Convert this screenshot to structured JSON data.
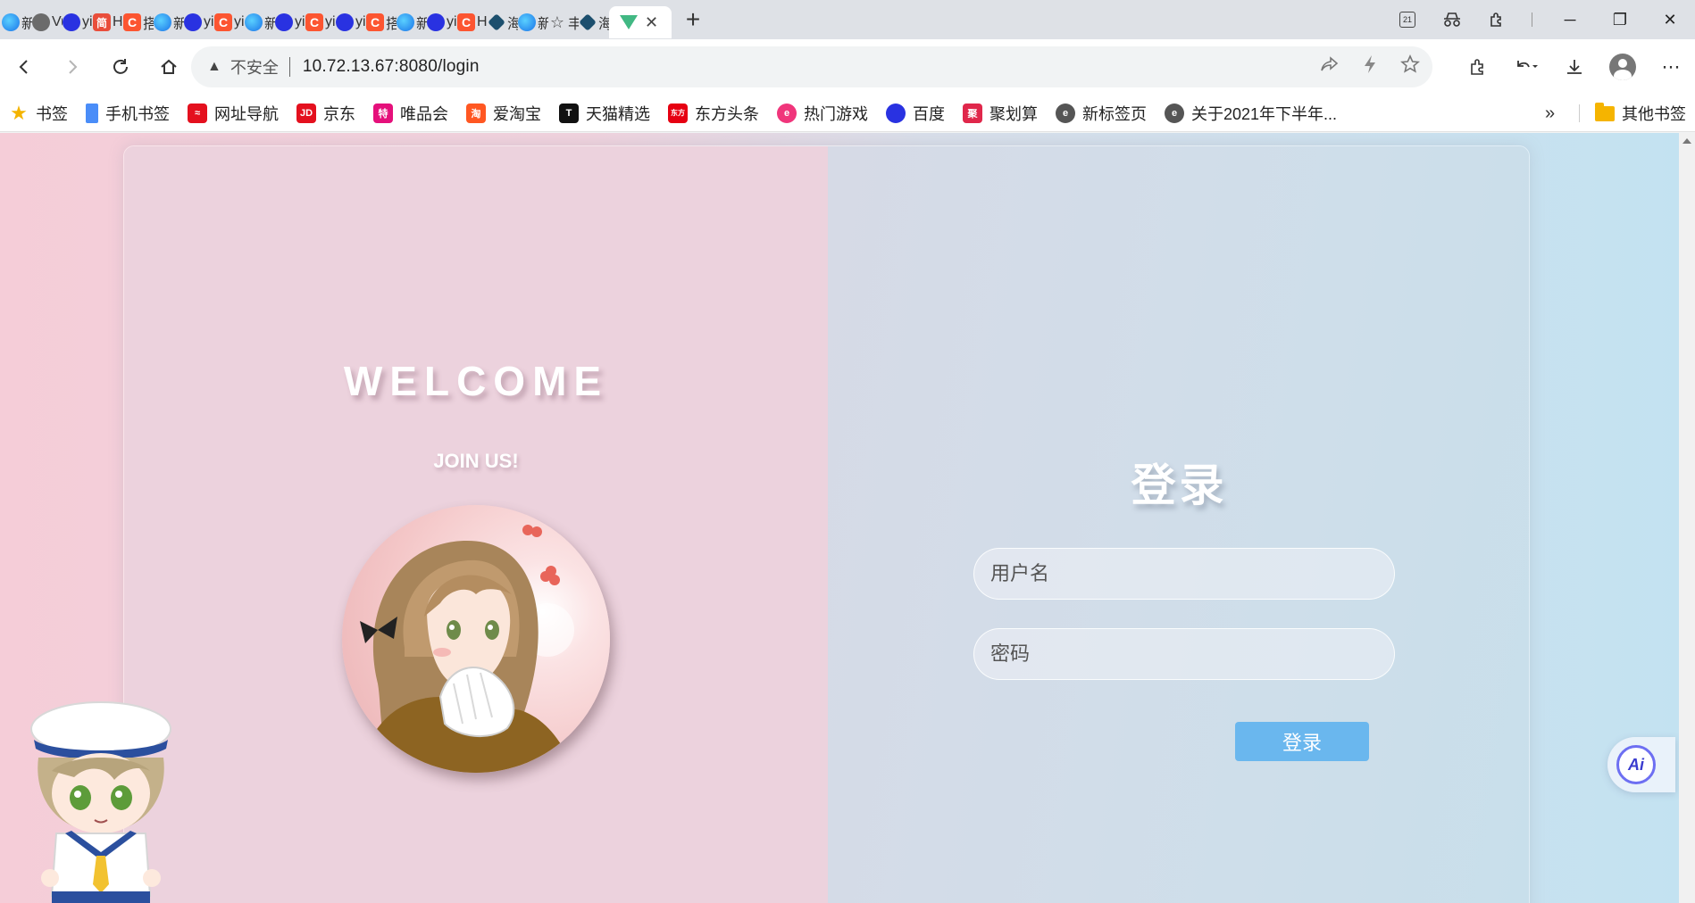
{
  "browser": {
    "tabs": [
      {
        "icon": "edge",
        "glyph": "",
        "title": "新"
      },
      {
        "icon": "ie",
        "glyph": "",
        "title": "Vu"
      },
      {
        "icon": "baidu",
        "glyph": "",
        "title": "yi"
      },
      {
        "icon": "jian",
        "glyph": "简",
        "title": "H"
      },
      {
        "icon": "csdn",
        "glyph": "C",
        "title": "搭"
      },
      {
        "icon": "edge",
        "glyph": "",
        "title": "新"
      },
      {
        "icon": "baidu",
        "glyph": "",
        "title": "yi"
      },
      {
        "icon": "csdn",
        "glyph": "C",
        "title": "yi"
      },
      {
        "icon": "edge",
        "glyph": "",
        "title": "新"
      },
      {
        "icon": "baidu",
        "glyph": "",
        "title": "yi"
      },
      {
        "icon": "csdn",
        "glyph": "C",
        "title": "yi"
      },
      {
        "icon": "baidu",
        "glyph": "",
        "title": "yi"
      },
      {
        "icon": "csdn",
        "glyph": "C",
        "title": "搭"
      },
      {
        "icon": "edge",
        "glyph": "",
        "title": "新"
      },
      {
        "icon": "baidu",
        "glyph": "",
        "title": "yi"
      },
      {
        "icon": "csdn",
        "glyph": "C",
        "title": "H"
      },
      {
        "icon": "haihe",
        "glyph": "",
        "title": "海"
      },
      {
        "icon": "edge",
        "glyph": "",
        "title": "新"
      },
      {
        "icon": "star",
        "glyph": "☆",
        "title": "丰"
      },
      {
        "icon": "haihe",
        "glyph": "",
        "title": "海"
      }
    ],
    "active_tab": {
      "icon": "vue",
      "close": "✕"
    },
    "new_tab": "+",
    "address": {
      "warning_icon": "▲",
      "insecure_label": "不安全",
      "url": "10.72.13.67:8080/login"
    },
    "bookmarks": [
      {
        "icon": "star",
        "glyph": "★",
        "label": "书签"
      },
      {
        "icon": "phone",
        "glyph": "",
        "label": "手机书签"
      },
      {
        "icon": "red",
        "glyph": "≈",
        "label": "网址导航"
      },
      {
        "icon": "red",
        "glyph": "JD",
        "label": "京东"
      },
      {
        "icon": "pink",
        "glyph": "特",
        "label": "唯品会"
      },
      {
        "icon": "orange",
        "glyph": "淘",
        "label": "爱淘宝"
      },
      {
        "icon": "black",
        "glyph": "T",
        "label": "天猫精选"
      },
      {
        "icon": "eastred",
        "glyph": "东方",
        "label": "东方头条"
      },
      {
        "icon": "game",
        "glyph": "e",
        "label": "热门游戏"
      },
      {
        "icon": "baidu",
        "glyph": "",
        "label": "百度"
      },
      {
        "icon": "ju",
        "glyph": "聚",
        "label": "聚划算"
      },
      {
        "icon": "ie",
        "glyph": "e",
        "label": "新标签页"
      },
      {
        "icon": "ie",
        "glyph": "e",
        "label": "关于2021年下半年..."
      }
    ],
    "bookmarks_more": "»",
    "other_bookmarks": "其他书签"
  },
  "page": {
    "welcome": "WELCOME",
    "join_us": "JOIN US!",
    "login_title": "登录",
    "username_placeholder": "用户名",
    "password_placeholder": "密码",
    "login_button": "登录",
    "ai_badge": "Ai"
  },
  "colors": {
    "login_button": "#6ab7ee",
    "left_panel": "#ecd2dd",
    "ai_ring": "#6d6ff2"
  }
}
